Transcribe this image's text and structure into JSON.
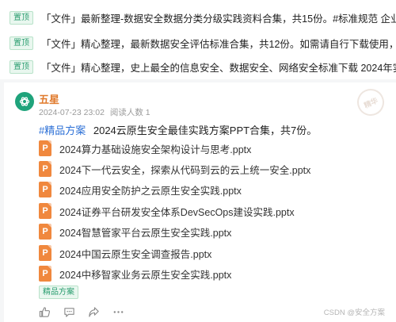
{
  "pinned": [
    {
      "badge": "置顶",
      "text": "「文件」最新整理-数据安全数据分类分级实践资料合集，共15份。#标准规范 企业数据安全建设"
    },
    {
      "badge": "置顶",
      "text": "「文件」精心整理，最新数据安全评估标准合集，共12份。如需请自行下载使用，请勿传阅。#标"
    },
    {
      "badge": "置顶",
      "text": "「文件」精心整理，史上最全的信息安全、数据安全、网络安全标准下载 2024年实施标准 GB-T"
    }
  ],
  "post": {
    "author": "五星",
    "date": "2024-07-23 23:02",
    "reads": "阅读人数 1",
    "stamp": "精华",
    "hashtag": "#精品方案",
    "title": "2024云原生安全最佳实践方案PPT合集，共7份。",
    "files": [
      {
        "icon": "P",
        "name": "2024算力基础设施安全架构设计与思考.pptx"
      },
      {
        "icon": "P",
        "name": "2024下一代云安全，探索从代码到云的云上统一安全.pptx"
      },
      {
        "icon": "P",
        "name": "2024应用安全防护之云原生安全实践.pptx"
      },
      {
        "icon": "P",
        "name": "2024证券平台研发安全体系DevSecOps建设实践.pptx"
      },
      {
        "icon": "P",
        "name": "2024智慧管家平台云原生安全实践.pptx"
      },
      {
        "icon": "P",
        "name": "2024中国云原生安全调查报告.pptx"
      },
      {
        "icon": "P",
        "name": "2024中移智家业务云原生安全实践.pptx"
      }
    ],
    "tag": "精品方案",
    "actions": [
      "like-icon",
      "comment-icon",
      "share-icon",
      "more-icon"
    ]
  },
  "watermark": "CSDN @安全方案",
  "colors": {
    "accent_green": "#2a9d6f",
    "author_orange": "#e07a2c",
    "hashtag_blue": "#2b6fd6",
    "ppt_orange": "#f0883e"
  }
}
